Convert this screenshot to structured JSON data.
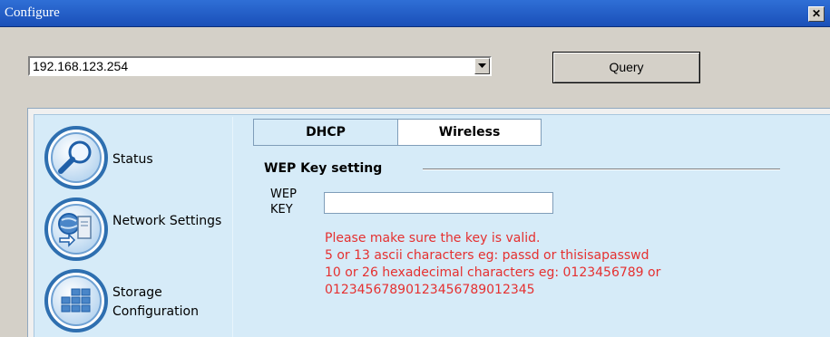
{
  "window": {
    "title": "Configure",
    "close_glyph": "✕"
  },
  "toolbar": {
    "ip_value": "192.168.123.254",
    "query_label": "Query"
  },
  "sidebar": {
    "items": [
      {
        "label": "Status",
        "icon": "magnifier-icon"
      },
      {
        "label": "Network Settings",
        "icon": "network-icon"
      },
      {
        "label": "Storage Configuration",
        "icon": "storage-grid-icon"
      }
    ]
  },
  "tabs": [
    {
      "label": "DHCP",
      "active": false
    },
    {
      "label": "Wireless",
      "active": true
    }
  ],
  "wep": {
    "group_title": "WEP Key setting",
    "field_label": "WEP KEY",
    "value": "",
    "hint_lines": [
      "Please make sure the key is valid.",
      "5 or 13 ascii characters eg: passd or thisisapasswd",
      "10 or 26 hexadecimal characters eg: 0123456789 or",
      "01234567890123456789012345"
    ]
  },
  "colors": {
    "titlebar": "#1a4fb8",
    "panel_bg": "#d6ebf8",
    "hint_text": "#e53030",
    "icon_ring": "#2e6fb0"
  }
}
